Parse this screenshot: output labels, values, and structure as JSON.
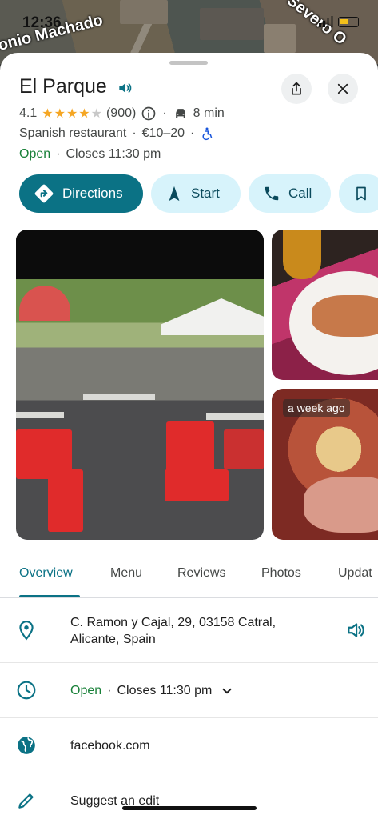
{
  "status": {
    "time": "12:36"
  },
  "map": {
    "labels": [
      "onio Machado",
      "Severo O"
    ]
  },
  "place": {
    "name": "El Parque",
    "rating": "4.1",
    "stars_filled": 4,
    "stars_total": 5,
    "review_count": "(900)",
    "drive_time": "8 min",
    "category": "Spanish restaurant",
    "price": "€10–20",
    "open_status": "Open",
    "closes": "Closes 11:30 pm"
  },
  "actions": {
    "directions": "Directions",
    "start": "Start",
    "call": "Call"
  },
  "photos": {
    "badge": "a week ago"
  },
  "tabs": [
    "Overview",
    "Menu",
    "Reviews",
    "Photos",
    "Updat"
  ],
  "details": {
    "address_line1": "C. Ramon y Cajal, 29, 03158 Catral,",
    "address_line2": "Alicante, Spain",
    "hours_status": "Open",
    "hours_closes": "Closes 11:30 pm",
    "website": "facebook.com",
    "suggest": "Suggest an edit"
  },
  "colors": {
    "accent": "#0b7285",
    "open_green": "#188038",
    "star": "#f5a623",
    "chip_light": "#d7f3fb"
  },
  "icons": [
    "speaker-icon",
    "share-icon",
    "close-icon",
    "info-icon",
    "car-icon",
    "accessibility-icon",
    "directions-icon",
    "navigation-arrow-icon",
    "phone-icon",
    "bookmark-icon",
    "location-pin-icon",
    "clock-icon",
    "chevron-down-icon",
    "globe-icon",
    "pencil-icon"
  ]
}
